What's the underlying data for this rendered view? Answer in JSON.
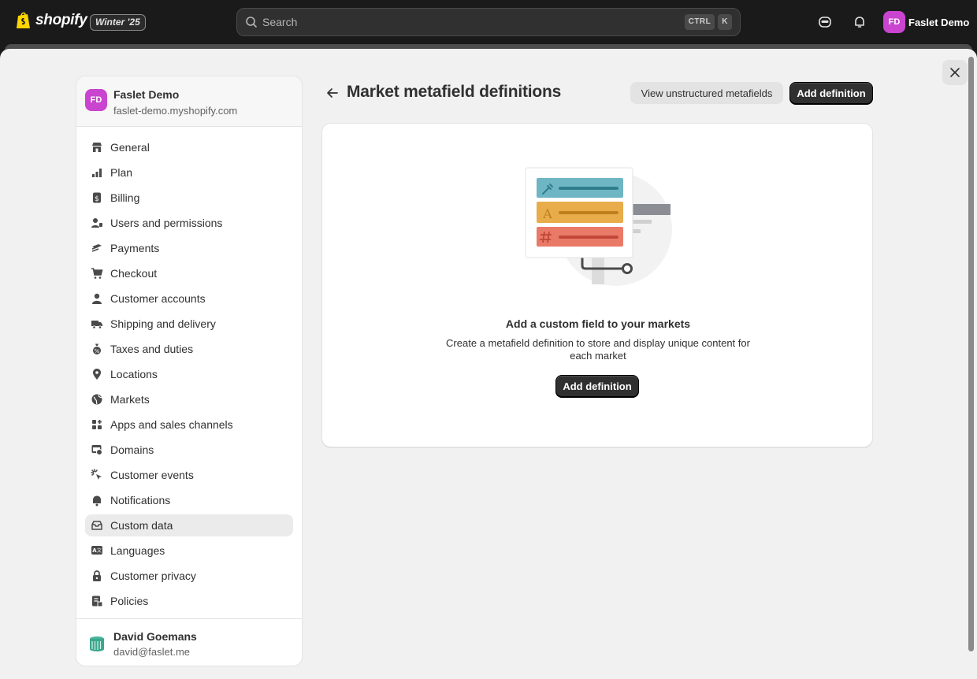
{
  "topbar": {
    "brand": "shopify",
    "edition": "Winter '25",
    "search_placeholder": "Search",
    "shortcut_keys": [
      "CTRL",
      "K"
    ],
    "user_initials": "FD",
    "user_name": "Faslet Demo"
  },
  "sidebar": {
    "store_initials": "FD",
    "store_name": "Faslet Demo",
    "store_domain": "faslet-demo.myshopify.com",
    "items": [
      {
        "label": "General",
        "icon": "store-icon"
      },
      {
        "label": "Plan",
        "icon": "plan-icon"
      },
      {
        "label": "Billing",
        "icon": "billing-icon"
      },
      {
        "label": "Users and permissions",
        "icon": "users-icon"
      },
      {
        "label": "Payments",
        "icon": "payments-icon"
      },
      {
        "label": "Checkout",
        "icon": "cart-icon"
      },
      {
        "label": "Customer accounts",
        "icon": "person-icon"
      },
      {
        "label": "Shipping and delivery",
        "icon": "truck-icon"
      },
      {
        "label": "Taxes and duties",
        "icon": "tax-icon"
      },
      {
        "label": "Locations",
        "icon": "location-icon"
      },
      {
        "label": "Markets",
        "icon": "globe-icon"
      },
      {
        "label": "Apps and sales channels",
        "icon": "apps-icon"
      },
      {
        "label": "Domains",
        "icon": "domains-icon"
      },
      {
        "label": "Customer events",
        "icon": "cursor-icon"
      },
      {
        "label": "Notifications",
        "icon": "bell-icon"
      },
      {
        "label": "Custom data",
        "icon": "custom-data-icon",
        "active": true
      },
      {
        "label": "Languages",
        "icon": "language-icon"
      },
      {
        "label": "Customer privacy",
        "icon": "lock-icon"
      },
      {
        "label": "Policies",
        "icon": "policies-icon"
      }
    ],
    "footer_user_name": "David Goemans",
    "footer_user_email": "david@faslet.me"
  },
  "main": {
    "title": "Market metafield definitions",
    "view_unstructured_label": "View unstructured metafields",
    "add_definition_label": "Add definition",
    "empty_state": {
      "heading": "Add a custom field to your markets",
      "description": "Create a metafield definition to store and display unique content for each market",
      "cta_label": "Add definition"
    }
  },
  "colors": {
    "brand_avatar": "#c944cf",
    "primary_button": "#303030",
    "illustration_teal": "#6fb6c4",
    "illustration_yellow": "#e8ad4a",
    "illustration_red": "#ea7a68"
  }
}
